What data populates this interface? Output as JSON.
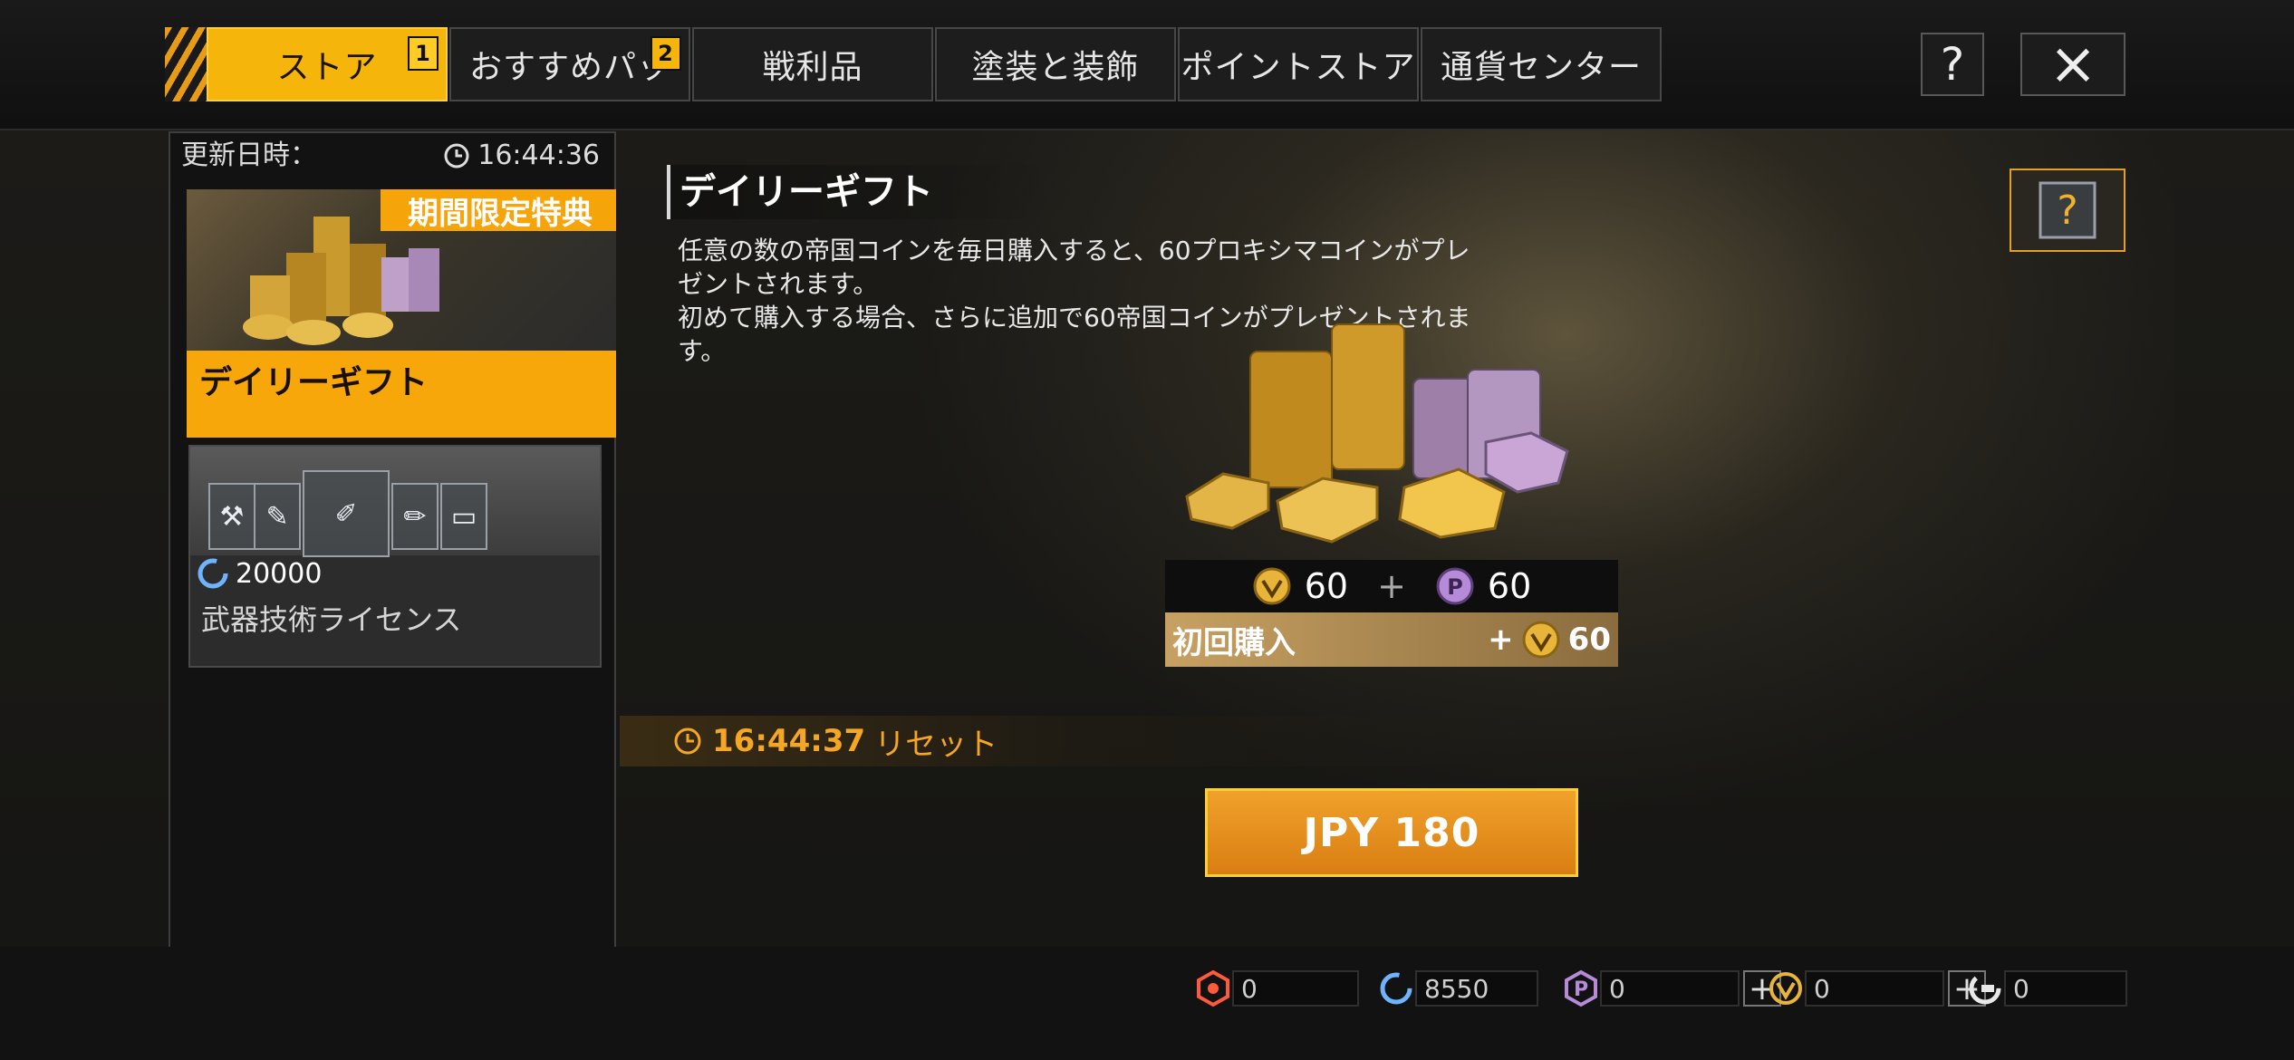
{
  "tabs": [
    {
      "label": "ストア",
      "badge": "1",
      "active": true
    },
    {
      "label": "おすすめパッ",
      "badge": "2",
      "active": false
    },
    {
      "label": "戦利品",
      "badge": "",
      "active": false
    },
    {
      "label": "塗装と装飾",
      "badge": "",
      "active": false
    },
    {
      "label": "ポイントストア",
      "badge": "",
      "active": false
    },
    {
      "label": "通貨センター",
      "badge": "",
      "active": false
    }
  ],
  "header": {
    "help_icon": "?",
    "close_icon": "×"
  },
  "left": {
    "update_label": "更新日時：",
    "update_time": "16:44:36",
    "card1": {
      "promo": "期間限定特典",
      "label": "デイリーギフト"
    },
    "card2": {
      "price": "20000",
      "label": "武器技術ライセンス"
    }
  },
  "main": {
    "title": "デイリーギフト",
    "desc1": "任意の数の帝国コインを毎日購入すると、60プロキシマコインがプレゼントされます。",
    "desc2": "初めて購入する場合、さらに追加で60帝国コインがプレゼントされます。",
    "reward_imperial": "60",
    "reward_plus": "+",
    "reward_proxima": "60",
    "first_purchase_label": "初回購入",
    "first_purchase_plus": "+",
    "first_purchase_amount": "60",
    "reset_time": "16:44:37",
    "reset_label": "リセット",
    "buy_label": "JPY 180"
  },
  "currencies": {
    "red": "0",
    "blue": "8550",
    "proxima": "0",
    "imperial": "0",
    "white": "0"
  },
  "colors": {
    "accent": "#f5b50a",
    "gold": "#e8b53a",
    "purple": "#b58ad8",
    "blue_coin": "#6fb3ff",
    "red_coin": "#ff5a3c"
  }
}
